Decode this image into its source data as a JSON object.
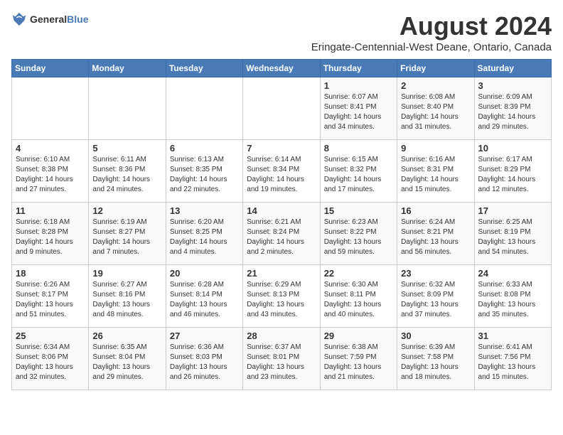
{
  "header": {
    "logo_general": "General",
    "logo_blue": "Blue",
    "title": "August 2024",
    "subtitle": "Eringate-Centennial-West Deane, Ontario, Canada"
  },
  "days_of_week": [
    "Sunday",
    "Monday",
    "Tuesday",
    "Wednesday",
    "Thursday",
    "Friday",
    "Saturday"
  ],
  "weeks": [
    [
      {
        "day": "",
        "info": ""
      },
      {
        "day": "",
        "info": ""
      },
      {
        "day": "",
        "info": ""
      },
      {
        "day": "",
        "info": ""
      },
      {
        "day": "1",
        "info": "Sunrise: 6:07 AM\nSunset: 8:41 PM\nDaylight: 14 hours\nand 34 minutes."
      },
      {
        "day": "2",
        "info": "Sunrise: 6:08 AM\nSunset: 8:40 PM\nDaylight: 14 hours\nand 31 minutes."
      },
      {
        "day": "3",
        "info": "Sunrise: 6:09 AM\nSunset: 8:39 PM\nDaylight: 14 hours\nand 29 minutes."
      }
    ],
    [
      {
        "day": "4",
        "info": "Sunrise: 6:10 AM\nSunset: 8:38 PM\nDaylight: 14 hours\nand 27 minutes."
      },
      {
        "day": "5",
        "info": "Sunrise: 6:11 AM\nSunset: 8:36 PM\nDaylight: 14 hours\nand 24 minutes."
      },
      {
        "day": "6",
        "info": "Sunrise: 6:13 AM\nSunset: 8:35 PM\nDaylight: 14 hours\nand 22 minutes."
      },
      {
        "day": "7",
        "info": "Sunrise: 6:14 AM\nSunset: 8:34 PM\nDaylight: 14 hours\nand 19 minutes."
      },
      {
        "day": "8",
        "info": "Sunrise: 6:15 AM\nSunset: 8:32 PM\nDaylight: 14 hours\nand 17 minutes."
      },
      {
        "day": "9",
        "info": "Sunrise: 6:16 AM\nSunset: 8:31 PM\nDaylight: 14 hours\nand 15 minutes."
      },
      {
        "day": "10",
        "info": "Sunrise: 6:17 AM\nSunset: 8:29 PM\nDaylight: 14 hours\nand 12 minutes."
      }
    ],
    [
      {
        "day": "11",
        "info": "Sunrise: 6:18 AM\nSunset: 8:28 PM\nDaylight: 14 hours\nand 9 minutes."
      },
      {
        "day": "12",
        "info": "Sunrise: 6:19 AM\nSunset: 8:27 PM\nDaylight: 14 hours\nand 7 minutes."
      },
      {
        "day": "13",
        "info": "Sunrise: 6:20 AM\nSunset: 8:25 PM\nDaylight: 14 hours\nand 4 minutes."
      },
      {
        "day": "14",
        "info": "Sunrise: 6:21 AM\nSunset: 8:24 PM\nDaylight: 14 hours\nand 2 minutes."
      },
      {
        "day": "15",
        "info": "Sunrise: 6:23 AM\nSunset: 8:22 PM\nDaylight: 13 hours\nand 59 minutes."
      },
      {
        "day": "16",
        "info": "Sunrise: 6:24 AM\nSunset: 8:21 PM\nDaylight: 13 hours\nand 56 minutes."
      },
      {
        "day": "17",
        "info": "Sunrise: 6:25 AM\nSunset: 8:19 PM\nDaylight: 13 hours\nand 54 minutes."
      }
    ],
    [
      {
        "day": "18",
        "info": "Sunrise: 6:26 AM\nSunset: 8:17 PM\nDaylight: 13 hours\nand 51 minutes."
      },
      {
        "day": "19",
        "info": "Sunrise: 6:27 AM\nSunset: 8:16 PM\nDaylight: 13 hours\nand 48 minutes."
      },
      {
        "day": "20",
        "info": "Sunrise: 6:28 AM\nSunset: 8:14 PM\nDaylight: 13 hours\nand 46 minutes."
      },
      {
        "day": "21",
        "info": "Sunrise: 6:29 AM\nSunset: 8:13 PM\nDaylight: 13 hours\nand 43 minutes."
      },
      {
        "day": "22",
        "info": "Sunrise: 6:30 AM\nSunset: 8:11 PM\nDaylight: 13 hours\nand 40 minutes."
      },
      {
        "day": "23",
        "info": "Sunrise: 6:32 AM\nSunset: 8:09 PM\nDaylight: 13 hours\nand 37 minutes."
      },
      {
        "day": "24",
        "info": "Sunrise: 6:33 AM\nSunset: 8:08 PM\nDaylight: 13 hours\nand 35 minutes."
      }
    ],
    [
      {
        "day": "25",
        "info": "Sunrise: 6:34 AM\nSunset: 8:06 PM\nDaylight: 13 hours\nand 32 minutes."
      },
      {
        "day": "26",
        "info": "Sunrise: 6:35 AM\nSunset: 8:04 PM\nDaylight: 13 hours\nand 29 minutes."
      },
      {
        "day": "27",
        "info": "Sunrise: 6:36 AM\nSunset: 8:03 PM\nDaylight: 13 hours\nand 26 minutes."
      },
      {
        "day": "28",
        "info": "Sunrise: 6:37 AM\nSunset: 8:01 PM\nDaylight: 13 hours\nand 23 minutes."
      },
      {
        "day": "29",
        "info": "Sunrise: 6:38 AM\nSunset: 7:59 PM\nDaylight: 13 hours\nand 21 minutes."
      },
      {
        "day": "30",
        "info": "Sunrise: 6:39 AM\nSunset: 7:58 PM\nDaylight: 13 hours\nand 18 minutes."
      },
      {
        "day": "31",
        "info": "Sunrise: 6:41 AM\nSunset: 7:56 PM\nDaylight: 13 hours\nand 15 minutes."
      }
    ]
  ]
}
